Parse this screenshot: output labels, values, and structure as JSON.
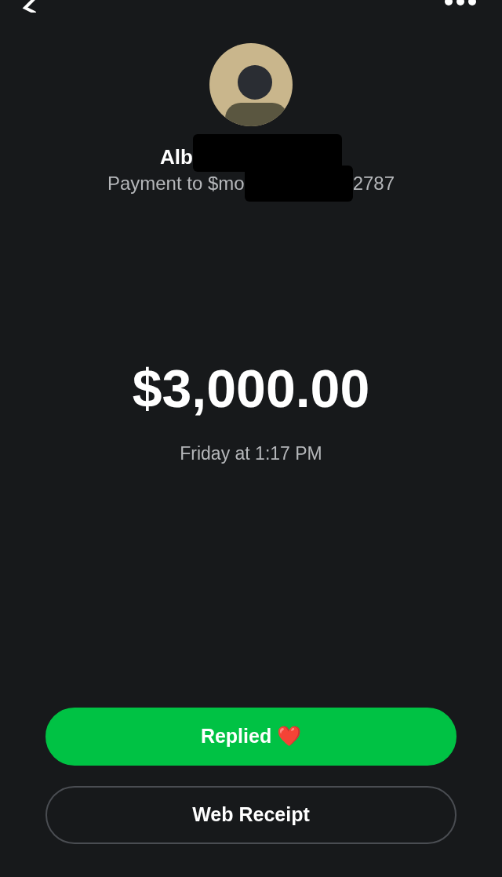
{
  "recipient": {
    "name_visible": "Alb",
    "payment_before": "Payment to $mo",
    "payment_after": "2787"
  },
  "amount": "$3,000.00",
  "time": "Friday at 1:17 PM",
  "buttons": [
    {
      "kind": "filled",
      "label": "Replied",
      "emoji": "❤️"
    },
    {
      "kind": "outline",
      "label": "Web Receipt"
    }
  ]
}
